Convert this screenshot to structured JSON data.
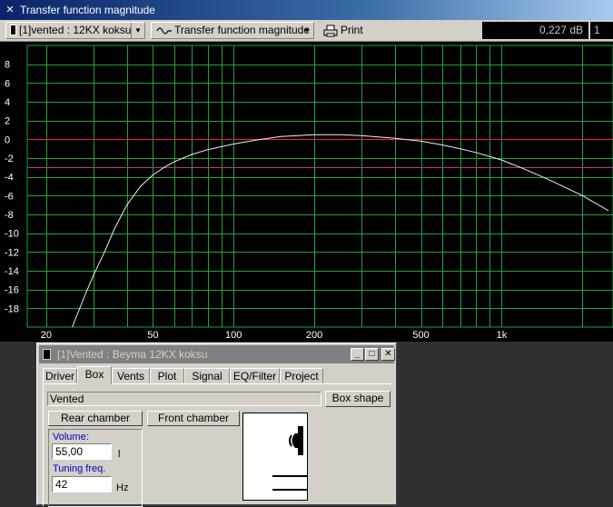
{
  "window": {
    "title": "Transfer function magnitude",
    "icon": "x-icon"
  },
  "toolbar": {
    "project_combo": "[1]vented : 12KX koksu",
    "view_combo": "Transfer function magnitude",
    "view_icon": "sine-wave-icon",
    "print_label": "Print",
    "print_icon": "printer-icon",
    "readout": "0,227 dB",
    "readout2": "1"
  },
  "chart_data": {
    "type": "line",
    "x_scale": "log",
    "xlim": [
      17,
      2600
    ],
    "ylim": [
      -20,
      10
    ],
    "x_tick_labels": [
      "20",
      "50",
      "100",
      "200",
      "500",
      "1k"
    ],
    "x_tick_values": [
      20,
      50,
      100,
      200,
      500,
      1000
    ],
    "y_tick_labels": [
      "8",
      "6",
      "4",
      "2",
      "0",
      "-2",
      "-4",
      "-6",
      "-8",
      "-10",
      "-12",
      "-14",
      "-16",
      "-18"
    ],
    "y_tick_values": [
      8,
      6,
      4,
      2,
      0,
      -2,
      -4,
      -6,
      -8,
      -10,
      -12,
      -14,
      -16,
      -18
    ],
    "reference_lines": [
      {
        "y": 0,
        "color": "#ff2020"
      },
      {
        "y": -3,
        "color": "#c03090"
      }
    ],
    "grid": true,
    "colors": {
      "background": "#000000",
      "grid": "#1fa43a",
      "curve": "#f0f0f0"
    },
    "series": [
      {
        "x": [
          25,
          28,
          30,
          33,
          36,
          40,
          45,
          50,
          55,
          60,
          70,
          80,
          100,
          120,
          150,
          200,
          250,
          300,
          400,
          500,
          600,
          700,
          800,
          1000,
          1200,
          1500,
          2000,
          2500
        ],
        "values": [
          -20,
          -16.5,
          -14.5,
          -12,
          -9.5,
          -7,
          -5,
          -3.8,
          -3.0,
          -2.4,
          -1.6,
          -1.1,
          -0.5,
          -0.1,
          0.3,
          0.5,
          0.5,
          0.4,
          0.1,
          -0.2,
          -0.6,
          -1.0,
          -1.4,
          -2.2,
          -3.1,
          -4.3,
          -6.0,
          -7.6
        ]
      }
    ]
  },
  "dialog": {
    "title": "[1]Vented : Beyma 12KX koksu",
    "icon": "document-icon",
    "tabs": [
      "Driver",
      "Box",
      "Vents",
      "Plot",
      "Signal",
      "EQ/Filter",
      "Project"
    ],
    "active_tab": "Box",
    "box_type": "Vented",
    "box_shape_label": "Box shape",
    "rear_chamber_label": "Rear chamber",
    "front_chamber_label": "Front chamber",
    "volume_label": "Volume:",
    "volume_value": "55,00",
    "volume_unit": "l",
    "tuning_label": "Tuning freq.",
    "tuning_value": "42",
    "tuning_unit": "Hz",
    "diagram_icon": "speaker-box-diagram-icon"
  }
}
